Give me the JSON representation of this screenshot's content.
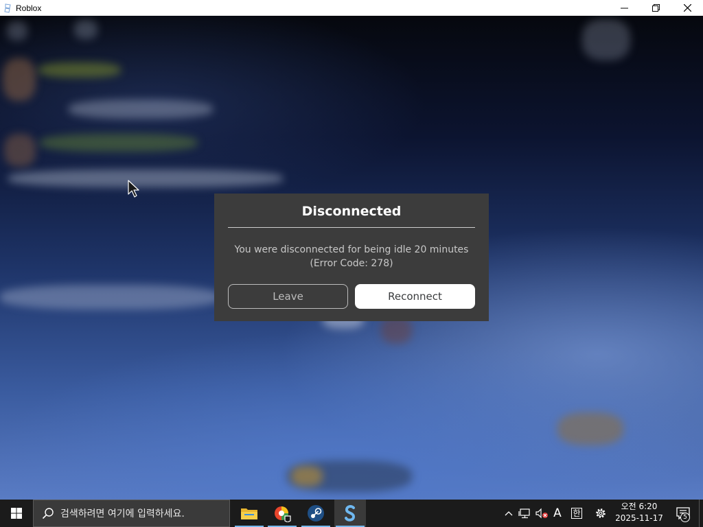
{
  "window": {
    "title": "Roblox",
    "controls": [
      "minimize",
      "restore",
      "close"
    ]
  },
  "dialog": {
    "title": "Disconnected",
    "message_line1": "You were disconnected for being idle 20 minutes",
    "message_line2": "(Error Code: 278)",
    "leave_label": "Leave",
    "reconnect_label": "Reconnect"
  },
  "taskbar": {
    "search_placeholder": "검색하려면 여기에 입력하세요.",
    "apps": [
      {
        "name": "file-explorer",
        "icon": "folder-icon"
      },
      {
        "name": "browser",
        "icon": "browser-icon"
      },
      {
        "name": "steam",
        "icon": "steam-icon"
      },
      {
        "name": "roblox",
        "icon": "roblox-icon",
        "active": true
      }
    ],
    "tray": {
      "input_mode": "A",
      "ime_label": "한",
      "time": "오전 6:20",
      "date": "2025-11-17",
      "notification_count": "5"
    }
  },
  "colors": {
    "dialog_bg": "#3c3c3c",
    "reconnect_bg": "#ffffff",
    "taskbar_bg": "#1b1b1b",
    "active_underline": "#76b9ed"
  }
}
